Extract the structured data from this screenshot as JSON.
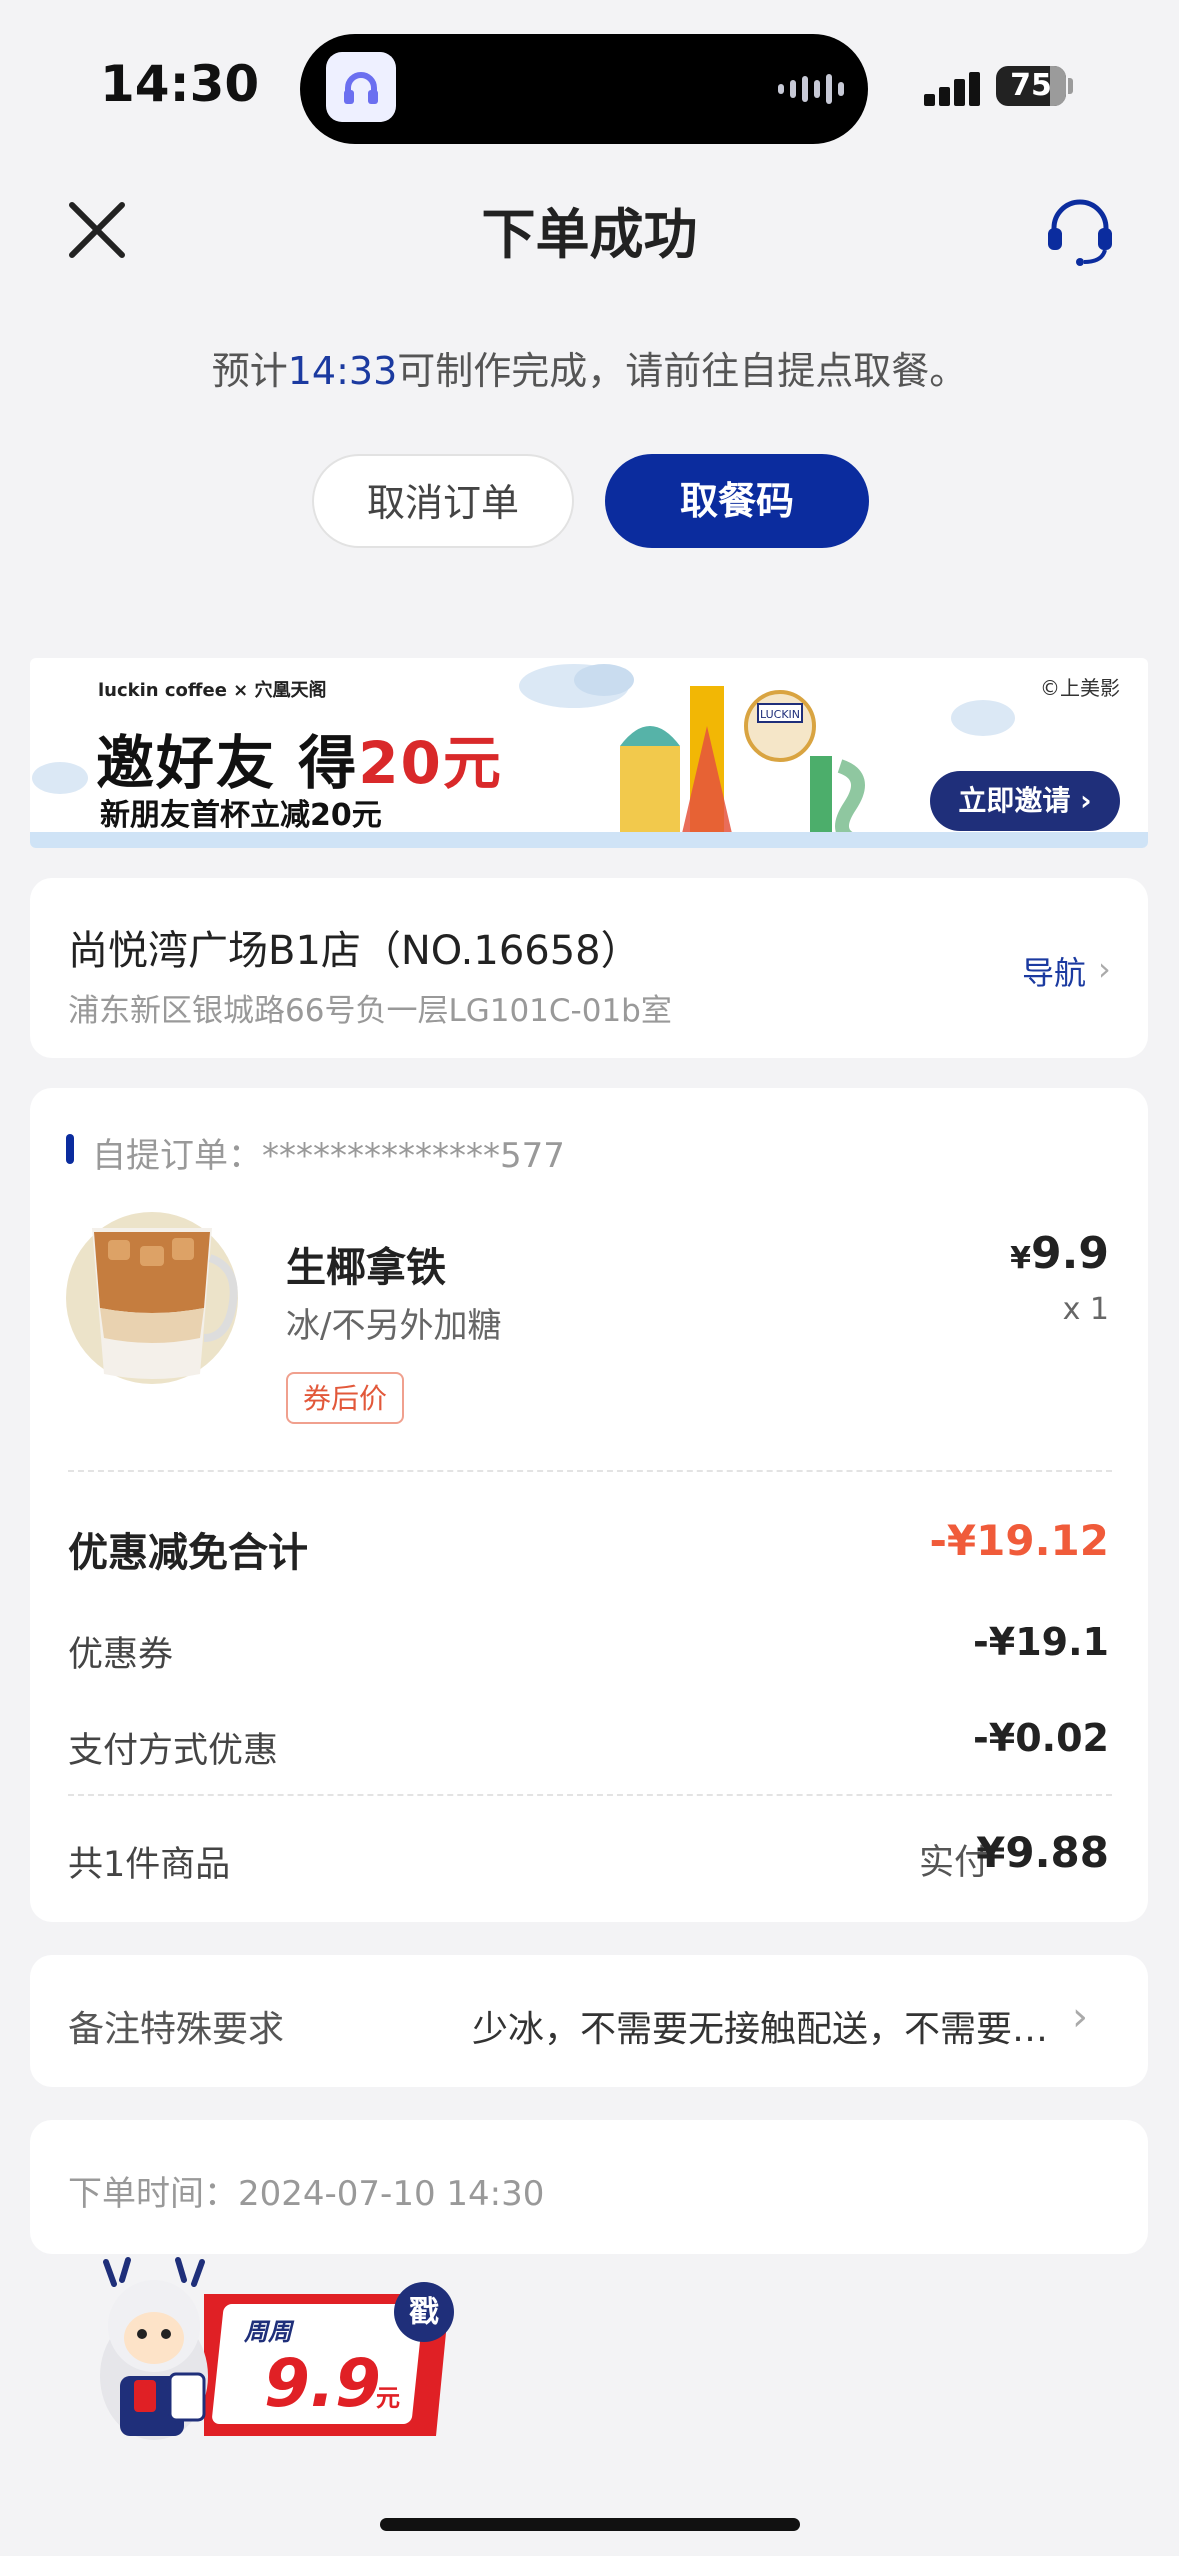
{
  "status_bar": {
    "time": "14:30",
    "battery": "75"
  },
  "header": {
    "title": "下单成功"
  },
  "estimate": {
    "prefix": "预计",
    "time": "14:33",
    "suffix": "可制作完成，请前往自提点取餐。"
  },
  "actions": {
    "cancel_label": "取消订单",
    "pickup_code_label": "取餐码"
  },
  "banner": {
    "brand": "luckin coffee × 穴凰天阁",
    "title_prefix": "邀好友 得",
    "title_highlight": "20元",
    "subtitle": "新朋友首杯立减20元",
    "credit": "©上美影",
    "button_label": "立即邀请 ›",
    "sign_text": "LUCKIN"
  },
  "store": {
    "name": "尚悦湾广场B1店（NO.16658）",
    "address": "浦东新区银城路66号负一层LG101C-01b室",
    "nav_label": "导航"
  },
  "order": {
    "label": "自提订单：",
    "number": "**************577",
    "item": {
      "name": "生椰拿铁",
      "spec": "冰/不另外加糖",
      "tag": "券后价",
      "price_symbol": "¥",
      "price": "9.9",
      "qty": "x 1"
    },
    "discount_total_label": "优惠减免合计",
    "discount_total_value": "-¥19.12",
    "coupon_label": "优惠券",
    "coupon_value": "-¥19.1",
    "payment_label": "支付方式优惠",
    "payment_value": "-¥0.02",
    "count_label": "共1件商品",
    "paid_label": "实付",
    "paid_value": "¥9.88"
  },
  "remark": {
    "label": "备注特殊要求",
    "value": "少冰，不需要无接触配送，不需要…"
  },
  "order_time": {
    "label": "下单时间：",
    "value": "2024-07-10 14:30"
  },
  "promo": {
    "line1": "周周",
    "price": "9.9",
    "unit": "元",
    "stamp": "戳"
  },
  "colors": {
    "primary": "#0b2c9e",
    "discount": "#f05b3a",
    "background": "#f3f3f5"
  }
}
